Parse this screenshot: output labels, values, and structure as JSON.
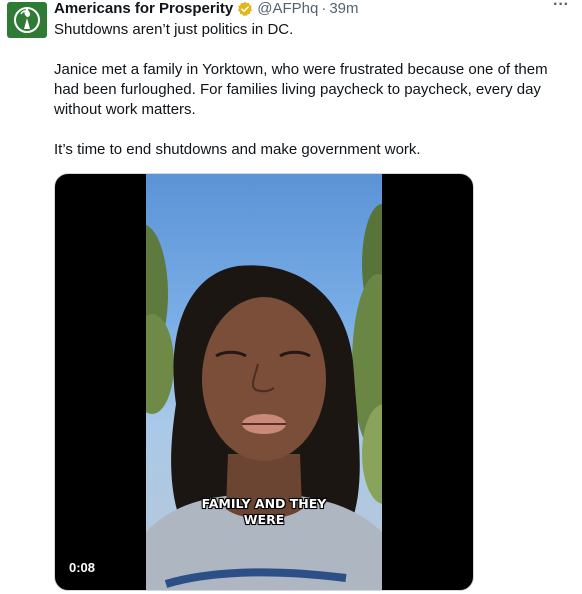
{
  "author": {
    "name": "Americans for Prosperity",
    "handle": "@AFPhq",
    "separator": "·",
    "time": "39m",
    "verified_color": "#e2b719"
  },
  "more_label": "···",
  "tweet": {
    "paragraphs": [
      "Shutdowns aren’t just politics in DC.",
      "Janice met a family in Yorktown, who were frustrated because one of them had been furloughed. For families living paycheck to paycheck, every day without work matters.",
      "It’s time to end shutdowns and make government work."
    ]
  },
  "video": {
    "caption_line1": "FAMILY AND THEY",
    "caption_line2": "WERE",
    "timestamp": "0:08"
  },
  "colors": {
    "avatar_bg": "#2f7a35",
    "text": "#0f1419",
    "muted": "#536471"
  },
  "icons": {
    "avatar": "torch-logo-icon",
    "verified": "verified-badge-icon",
    "more": "more-options-icon"
  }
}
